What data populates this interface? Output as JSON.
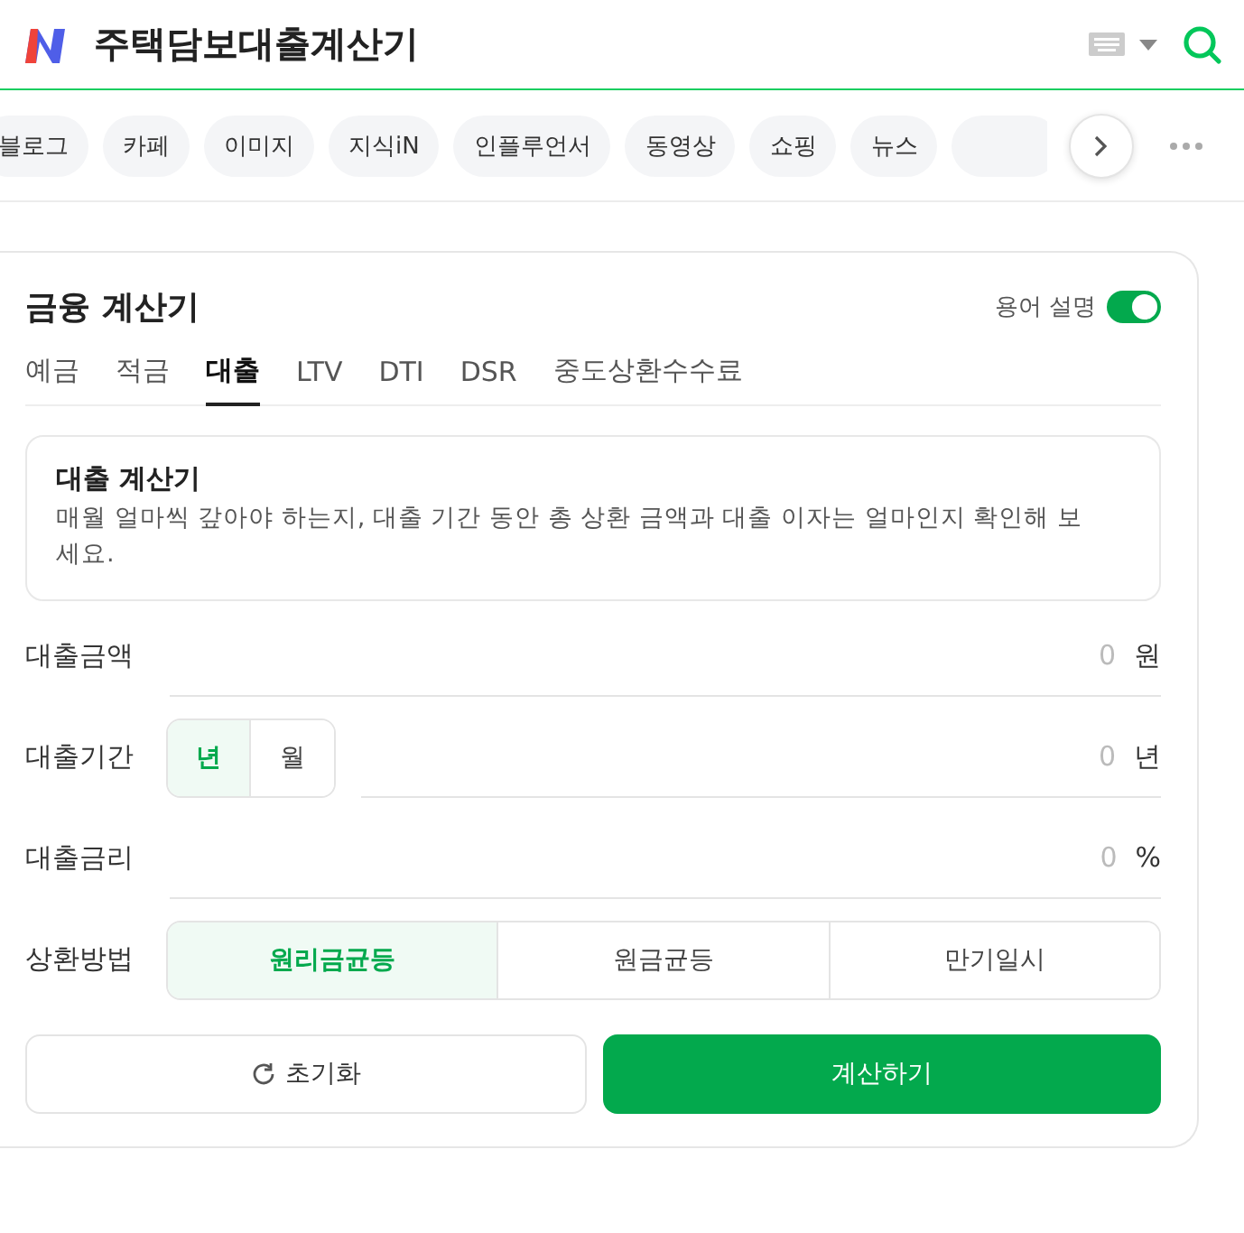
{
  "header": {
    "title": "주택담보대출계산기"
  },
  "chips": [
    {
      "label": "블로그"
    },
    {
      "label": "카페"
    },
    {
      "label": "이미지"
    },
    {
      "label": "지식iN"
    },
    {
      "label": "인플루언서"
    },
    {
      "label": "동영상"
    },
    {
      "label": "쇼핑"
    },
    {
      "label": "뉴스"
    }
  ],
  "calculator": {
    "title": "금융 계산기",
    "glossary": {
      "label": "용어 설명",
      "on": true
    },
    "tabs": [
      {
        "label": "예금",
        "selected": false
      },
      {
        "label": "적금",
        "selected": false
      },
      {
        "label": "대출",
        "selected": true
      },
      {
        "label": "LTV",
        "selected": false
      },
      {
        "label": "DTI",
        "selected": false
      },
      {
        "label": "DSR",
        "selected": false
      },
      {
        "label": "중도상환수수료",
        "selected": false
      }
    ],
    "intro": {
      "title": "대출 계산기",
      "text": "매월 얼마씩 갚아야 하는지, 대출 기간 동안 총 상환 금액과 대출 이자는 얼마인지 확인해 보세요."
    },
    "fields": [
      {
        "label": "대출금액",
        "placeholder": "0",
        "unit": "원"
      },
      {
        "label": "대출기간",
        "placeholder": "0",
        "unit": "년",
        "toggle": [
          {
            "label": "년",
            "selected": true
          },
          {
            "label": "월",
            "selected": false
          }
        ]
      },
      {
        "label": "대출금리",
        "placeholder": "0",
        "unit": "%"
      }
    ],
    "method": {
      "label": "상환방법",
      "options": [
        {
          "label": "원리금균등",
          "selected": true
        },
        {
          "label": "원금균등",
          "selected": false
        },
        {
          "label": "만기일시",
          "selected": false
        }
      ]
    },
    "buttons": {
      "reset": "초기화",
      "submit": "계산하기"
    }
  }
}
